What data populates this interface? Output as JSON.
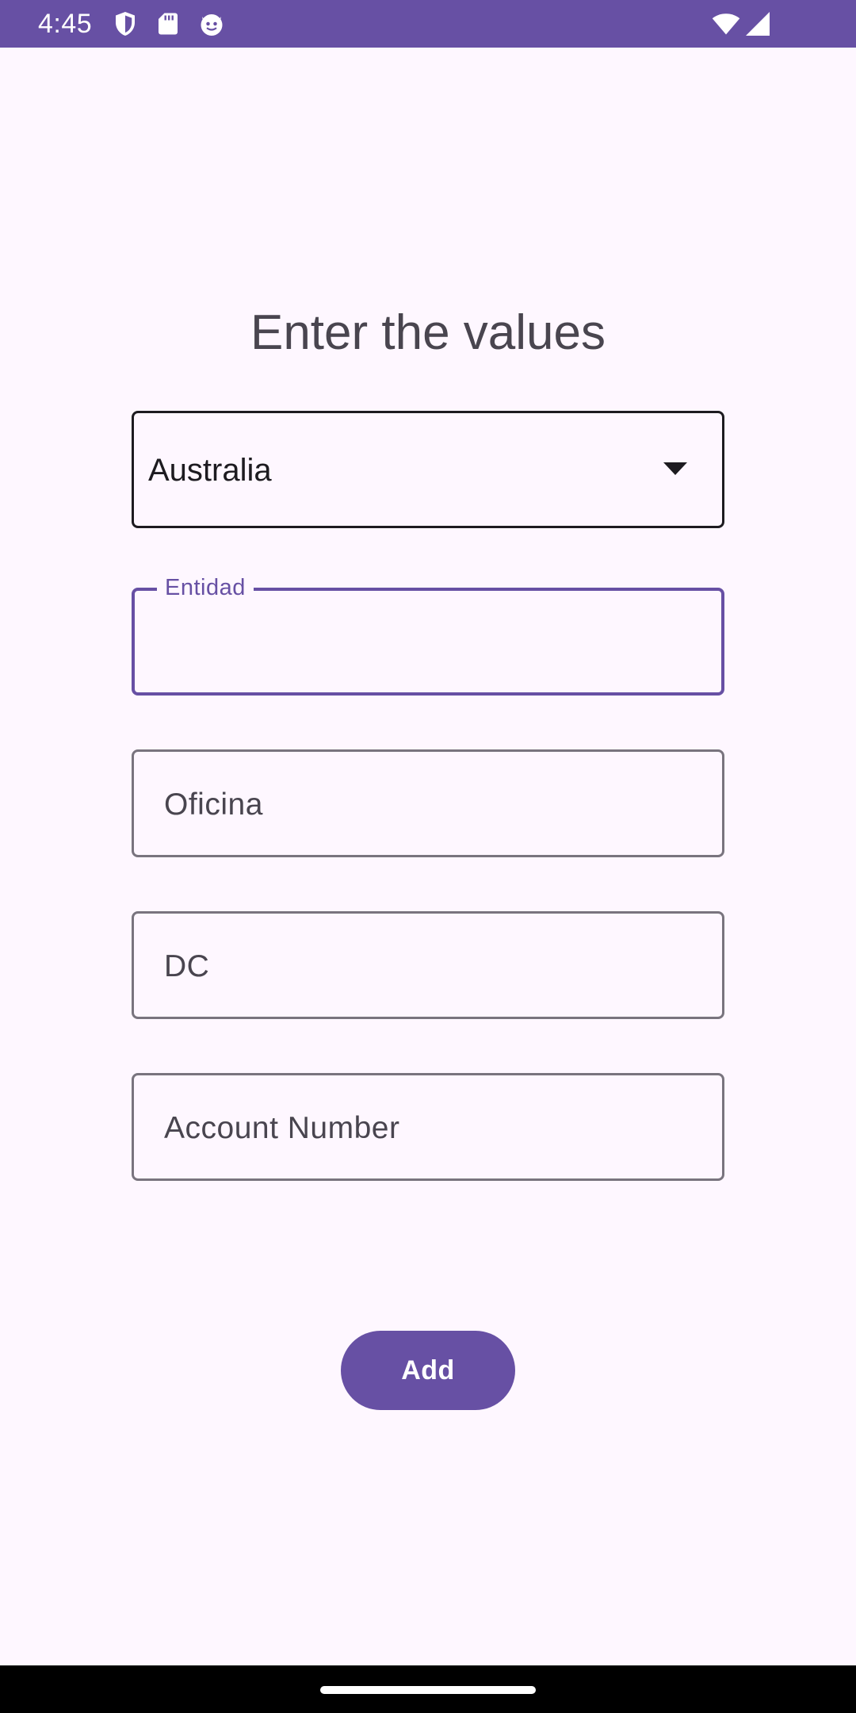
{
  "status_bar": {
    "time": "4:45",
    "background_color": "#6750A4",
    "left_icons": [
      "shield-icon",
      "sd-card-icon",
      "cat-face-icon"
    ],
    "right_icons": [
      "wifi-icon",
      "signal-icon"
    ]
  },
  "form": {
    "title": "Enter the values",
    "country_dropdown": {
      "selected": "Australia"
    },
    "entidad": {
      "label": "Entidad",
      "value": ""
    },
    "oficina": {
      "placeholder": "Oficina"
    },
    "dc": {
      "placeholder": "DC"
    },
    "account_number": {
      "placeholder": "Account Number"
    },
    "add_button_label": "Add"
  },
  "colors": {
    "primary": "#6750A4",
    "background": "#FEF7FF",
    "outline": "#79747E",
    "on_surface": "#1D1B20"
  }
}
